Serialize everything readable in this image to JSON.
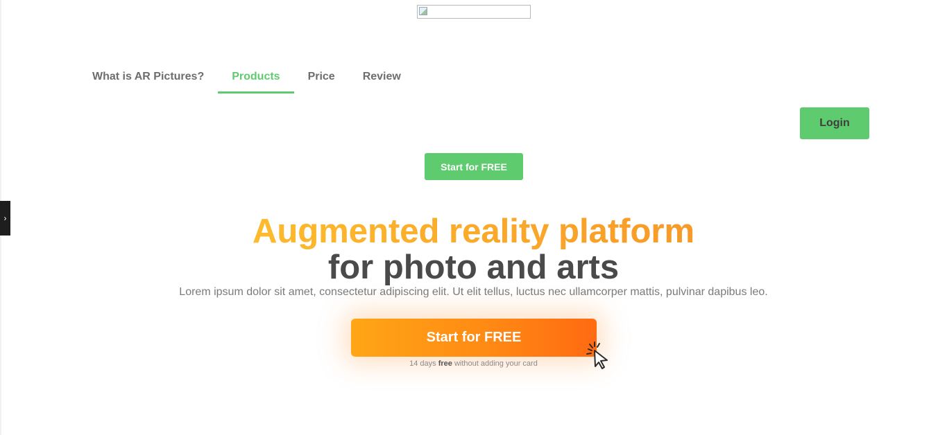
{
  "logo": {
    "alt": ""
  },
  "nav": {
    "items": [
      {
        "label": "What is AR Pictures?",
        "active": false
      },
      {
        "label": "Products",
        "active": true
      },
      {
        "label": "Price",
        "active": false
      },
      {
        "label": "Review",
        "active": false
      }
    ]
  },
  "header": {
    "login_label": "Login",
    "start_small_label": "Start for FREE"
  },
  "side_toggle": {
    "icon": "chevron-right-icon",
    "glyph": "›"
  },
  "hero": {
    "title_line1": "Augmented reality platform",
    "title_line2": "for photo and arts",
    "subtitle": "Lorem ipsum dolor sit amet, consectetur adipiscing elit. Ut elit tellus, luctus nec ullamcorper mattis, pulvinar dapibus leo.",
    "cta_label": "Start for FREE",
    "note_prefix": "14 days ",
    "note_bold": "free",
    "note_suffix": " without adding your card"
  },
  "colors": {
    "brand_green": "#5ecb6e",
    "title_orange": "#f9a63a",
    "cta_orange_start": "#ffa616",
    "cta_orange_end": "#ff6a12",
    "dark_text": "#4a4a4a"
  },
  "icons": {
    "cursor": "click-cursor-icon"
  }
}
